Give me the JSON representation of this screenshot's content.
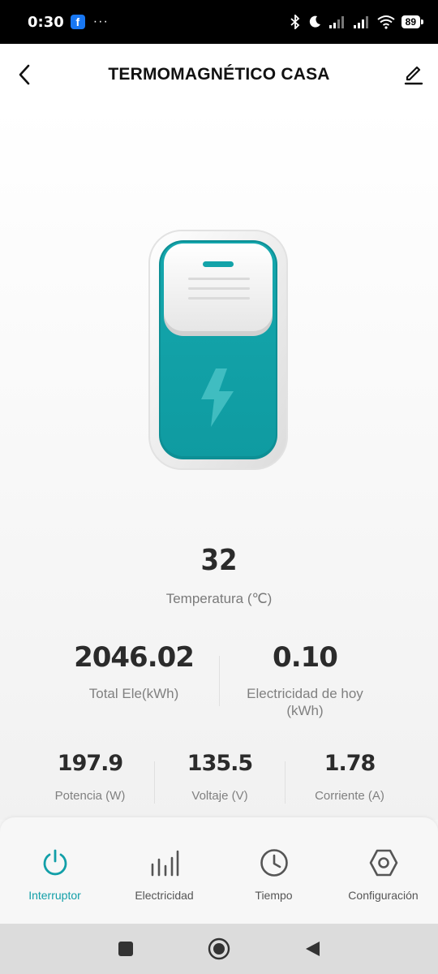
{
  "status_bar": {
    "time": "0:30",
    "app_icon": "facebook-icon",
    "more": "···",
    "battery": "89"
  },
  "header": {
    "title": "TERMOMAGNÉTICO CASA",
    "back_icon": "chevron-left-icon",
    "edit_icon": "pencil-icon"
  },
  "device": {
    "icon": "lightning-icon",
    "accent_color": "#13a3a9"
  },
  "temperature": {
    "value": "32",
    "label": "Temperatura (℃)"
  },
  "stats_primary": [
    {
      "value": "2046.02",
      "label": "Total Ele(kWh)"
    },
    {
      "value": "0.10",
      "label": "Electricidad de hoy (kWh)"
    }
  ],
  "stats_secondary": [
    {
      "value": "197.9",
      "label": "Potencia (W)"
    },
    {
      "value": "135.5",
      "label": "Voltaje (V)"
    },
    {
      "value": "1.78",
      "label": "Corriente (A)"
    }
  ],
  "tabs": [
    {
      "label": "Interruptor",
      "icon": "power-icon",
      "active": true
    },
    {
      "label": "Electricidad",
      "icon": "bar-chart-icon",
      "active": false
    },
    {
      "label": "Tiempo",
      "icon": "clock-icon",
      "active": false
    },
    {
      "label": "Configuración",
      "icon": "hexagon-settings-icon",
      "active": false
    }
  ],
  "colors": {
    "accent": "#129fa8",
    "text_primary": "#2b2b2b",
    "text_secondary": "#808080"
  }
}
